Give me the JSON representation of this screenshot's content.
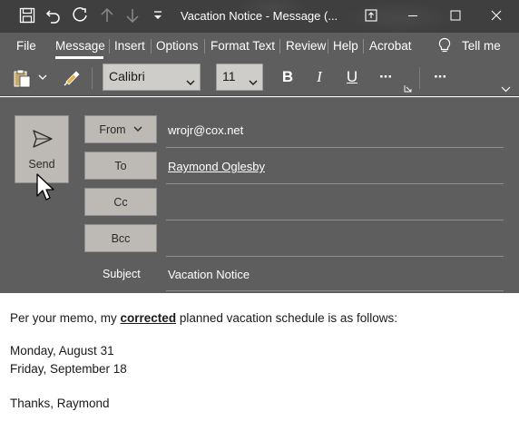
{
  "titlebar": {
    "title": "Vacation Notice  -  Message (...",
    "icons": [
      "save-icon",
      "undo-icon",
      "redo-icon",
      "arrow-up-icon",
      "arrow-down-icon",
      "customize-qat-icon"
    ],
    "window_buttons": [
      "ribbon-display-icon",
      "minimize-icon",
      "maximize-icon",
      "close-icon"
    ]
  },
  "menu": {
    "items": [
      "File",
      "Message",
      "Insert",
      "Options",
      "Format Text",
      "Review",
      "Help",
      "Acrobat"
    ],
    "active": "Message",
    "tell_me": "Tell me"
  },
  "ribbon": {
    "font_name": "Calibri",
    "font_size": "11",
    "bold": "B",
    "italic": "I",
    "underline": "U",
    "more": "···"
  },
  "header": {
    "send_label": "Send",
    "from_label": "From",
    "from_value": "wrojr@cox.net",
    "to_label": "To",
    "to_value": "Raymond Oglesby",
    "cc_label": "Cc",
    "cc_value": "",
    "bcc_label": "Bcc",
    "bcc_value": "",
    "subject_label": "Subject",
    "subject_value": "Vacation Notice"
  },
  "body": {
    "line1_pre": "Per your memo, my ",
    "line1_emph": "corrected",
    "line1_post": " planned vacation schedule is as follows:",
    "date1": "Monday, August 31",
    "date2": "Friday, September 18",
    "signoff": "Thanks, Raymond"
  },
  "colors": {
    "titlebar_bg": "#3f3f3f",
    "chrome_bg": "#5e5e5e",
    "button_bg": "#bdbab5",
    "body_bg": "#ffffff"
  }
}
